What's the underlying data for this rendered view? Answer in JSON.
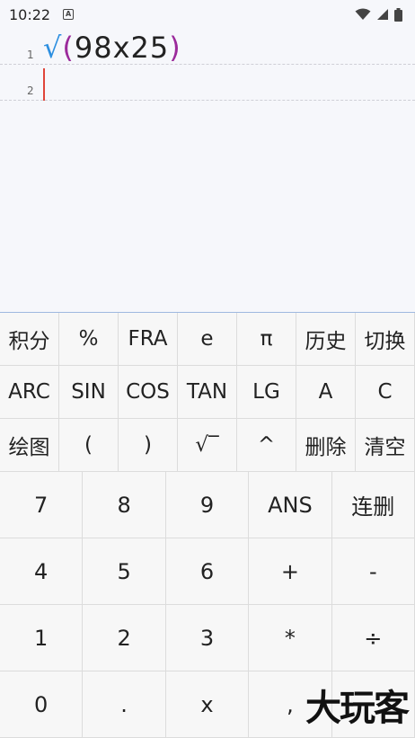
{
  "status": {
    "time": "10:22",
    "a_badge": "A"
  },
  "editor": {
    "lines": [
      {
        "num": "1",
        "sqrt": "√",
        "open": "(",
        "body": "98x25",
        "close": ")"
      },
      {
        "num": "2"
      }
    ]
  },
  "keys_small": [
    "积分",
    "%",
    "FRA",
    "e",
    "π",
    "历史",
    "切换",
    "ARC",
    "SIN",
    "COS",
    "TAN",
    "LG",
    "A",
    "C",
    "绘图",
    "(",
    ")",
    "√‾",
    "^",
    "删除",
    "清空"
  ],
  "keys_big": [
    "7",
    "8",
    "9",
    "ANS",
    "连删",
    "4",
    "5",
    "6",
    "+",
    "-",
    "1",
    "2",
    "3",
    "*",
    "÷",
    "0",
    ".",
    "x",
    ",",
    ""
  ],
  "watermark": "大玩客"
}
